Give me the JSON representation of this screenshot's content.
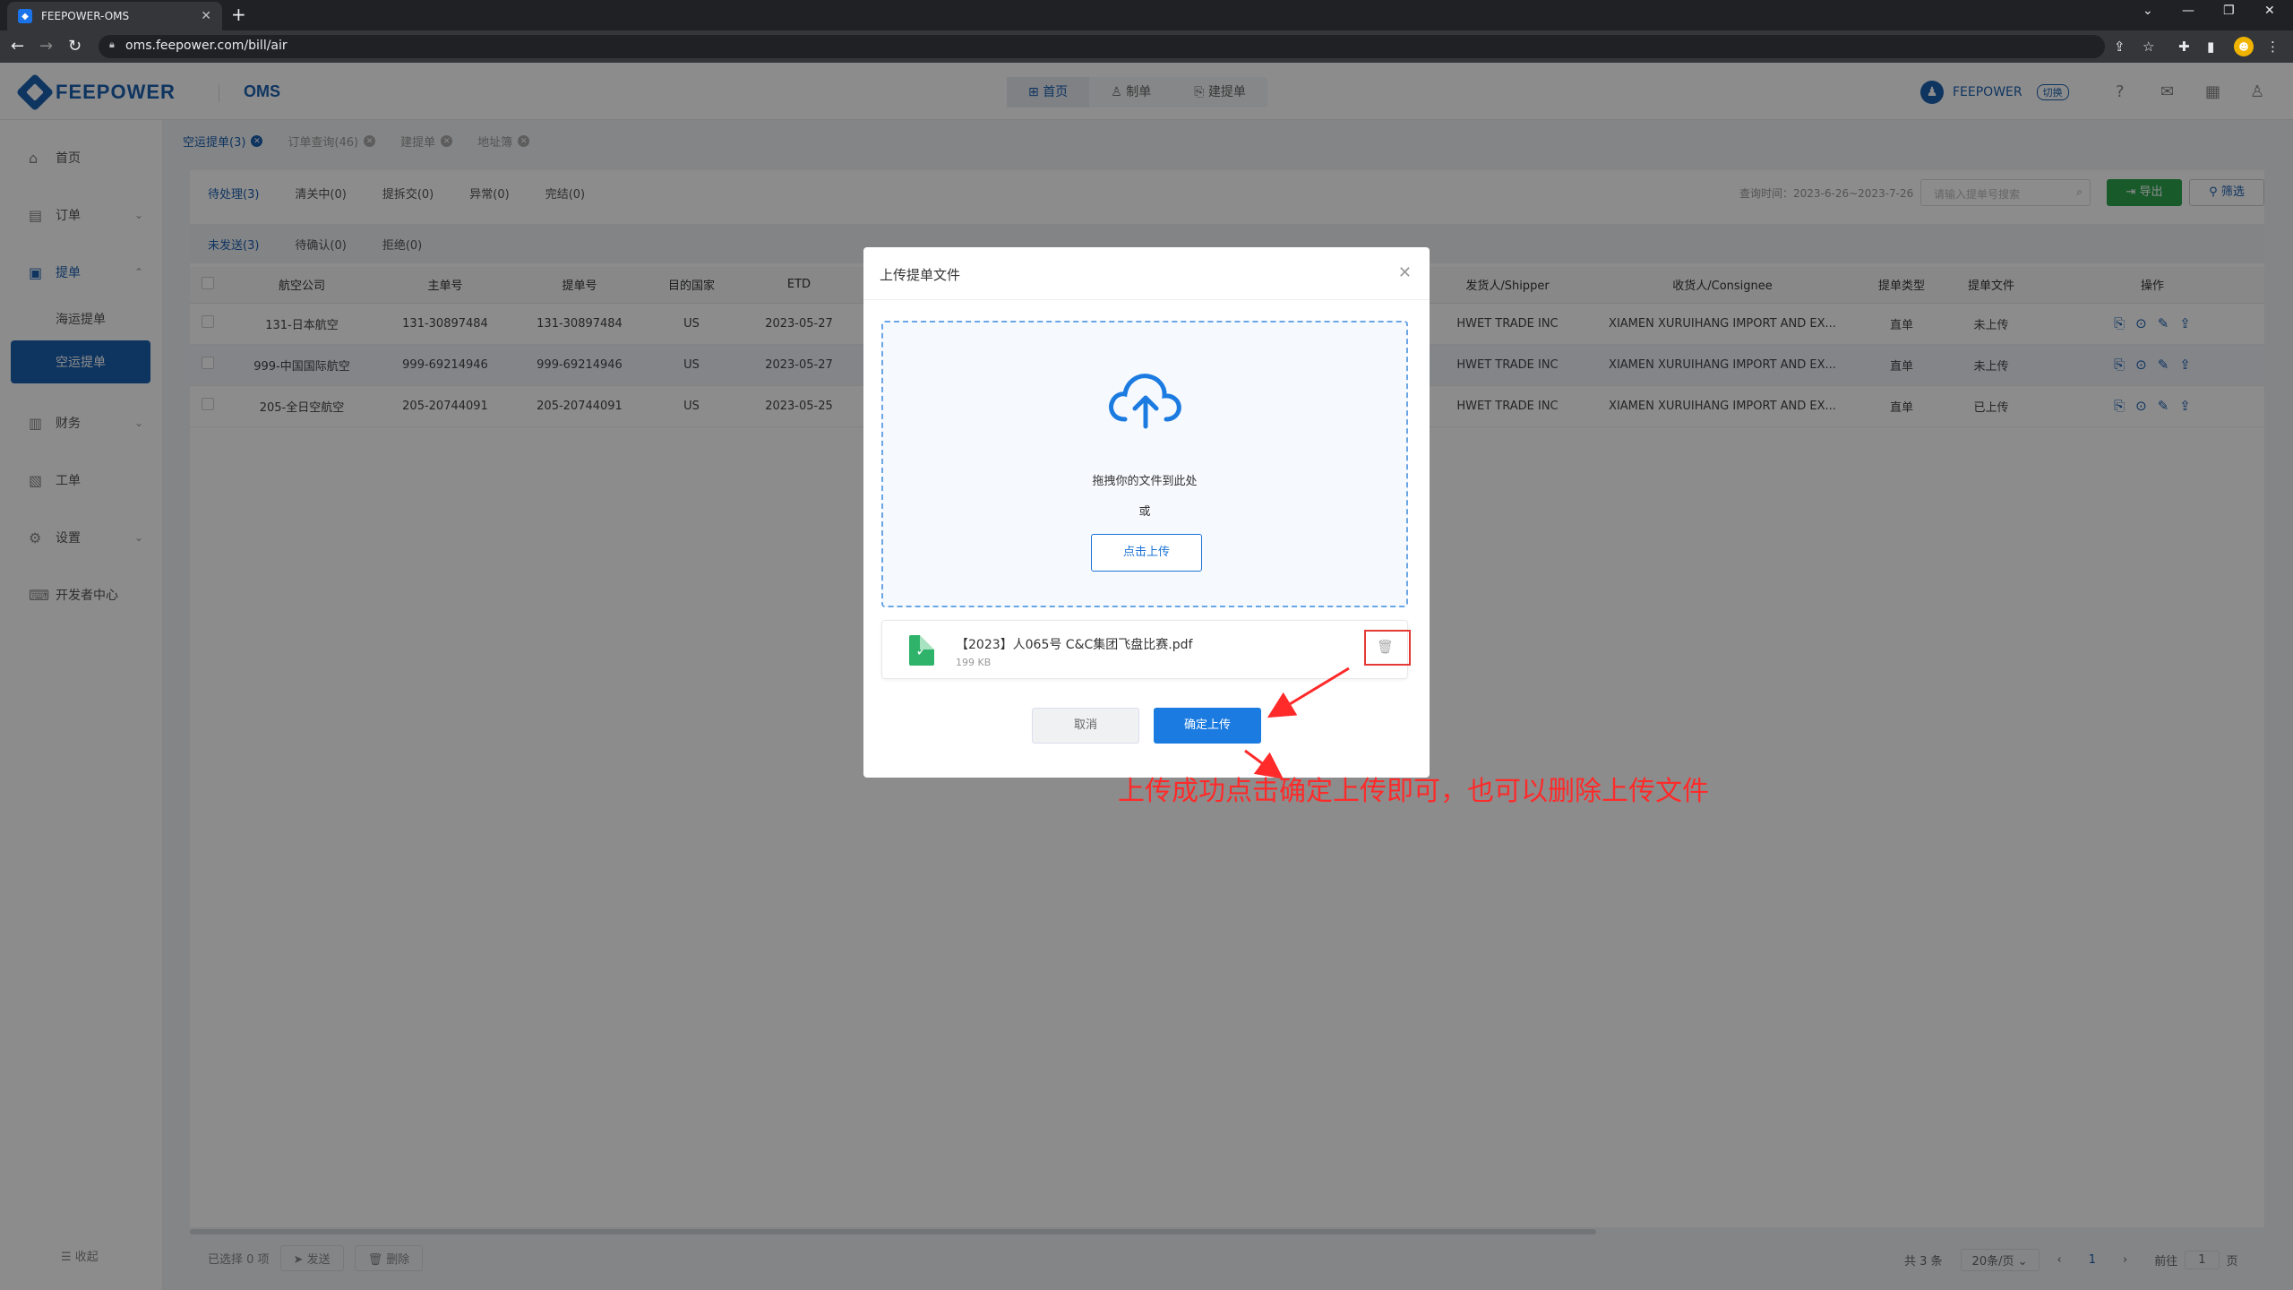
{
  "browser": {
    "tab_title": "FEEPOWER-OMS",
    "url": "oms.feepower.com/bill/air"
  },
  "header": {
    "brand": "FEEPOWER",
    "app": "OMS",
    "nav": [
      {
        "label": "首页",
        "icon": "grid-icon"
      },
      {
        "label": "制单",
        "icon": "user-icon"
      },
      {
        "label": "建提单",
        "icon": "doc-add-icon"
      }
    ],
    "user": "FEEPOWER",
    "switch_label": "切换"
  },
  "sidebar": {
    "items": [
      {
        "label": "首页",
        "icon": "home-icon"
      },
      {
        "label": "订单",
        "icon": "order-icon"
      },
      {
        "label": "提单",
        "icon": "bill-icon"
      },
      {
        "label": "财务",
        "icon": "finance-icon"
      },
      {
        "label": "工单",
        "icon": "ticket-icon"
      },
      {
        "label": "设置",
        "icon": "gear-icon"
      },
      {
        "label": "开发者中心",
        "icon": "dev-icon"
      }
    ],
    "sub_items": [
      "海运提单",
      "空运提单"
    ],
    "collapse": "收起"
  },
  "page_tabs": [
    "空运提单(3)",
    "订单查询(46)",
    "建提单",
    "地址簿"
  ],
  "status_tabs": [
    "待处理(3)",
    "清关中(0)",
    "提拆交(0)",
    "异常(0)",
    "完结(0)"
  ],
  "query_time": "查询时间：2023-6-26~2023-7-26",
  "search_placeholder": "请输入提单号搜索",
  "export_label": "导出",
  "filter_label": "筛选",
  "sub_tabs": [
    "未发送(3)",
    "待确认(0)",
    "拒绝(0)"
  ],
  "table": {
    "headers": [
      "航空公司",
      "主单号",
      "提单号",
      "目的国家",
      "ETD",
      "发货人/Shipper",
      "收货人/Consignee",
      "提单类型",
      "提单文件",
      "操作"
    ],
    "rows": [
      {
        "airline": "131-日本航空",
        "master": "131-30897484",
        "bill": "131-30897484",
        "country": "US",
        "etd": "2023-05-27",
        "shipper": "HWET TRADE INC",
        "consignee": "XIAMEN XURUIHANG IMPORT AND EX...",
        "type": "直单",
        "file": "未上传"
      },
      {
        "airline": "999-中国国际航空",
        "master": "999-69214946",
        "bill": "999-69214946",
        "country": "US",
        "etd": "2023-05-27",
        "shipper": "HWET TRADE INC",
        "consignee": "XIAMEN XURUIHANG IMPORT AND EX...",
        "type": "直单",
        "file": "未上传"
      },
      {
        "airline": "205-全日空航空",
        "master": "205-20744091",
        "bill": "205-20744091",
        "country": "US",
        "etd": "2023-05-25",
        "shipper": "HWET TRADE INC",
        "consignee": "XIAMEN XURUIHANG IMPORT AND EX...",
        "type": "直单",
        "file": "已上传"
      }
    ]
  },
  "footer": {
    "selected": "已选择 0 项",
    "send": "发送",
    "delete": "删除",
    "total": "共 3 条",
    "page_size": "20条/页",
    "page": "1",
    "goto": "前往",
    "goto_value": "1",
    "page_suffix": "页"
  },
  "modal": {
    "title": "上传提单文件",
    "drag_text": "拖拽你的文件到此处",
    "or_text": "或",
    "click_upload": "点击上传",
    "file_name": "【2023】人065号 C&C集团飞盘比赛.pdf",
    "file_size": "199 KB",
    "cancel": "取消",
    "confirm": "确定上传"
  },
  "annotation": "上传成功点击确定上传即可，也可以删除上传文件",
  "colors": {
    "brand": "#1b5fb0",
    "primary_button": "#1b7be0",
    "export_button": "#2ea44f",
    "annotation": "#ff2a2a",
    "file_icon": "#2fb36b"
  }
}
